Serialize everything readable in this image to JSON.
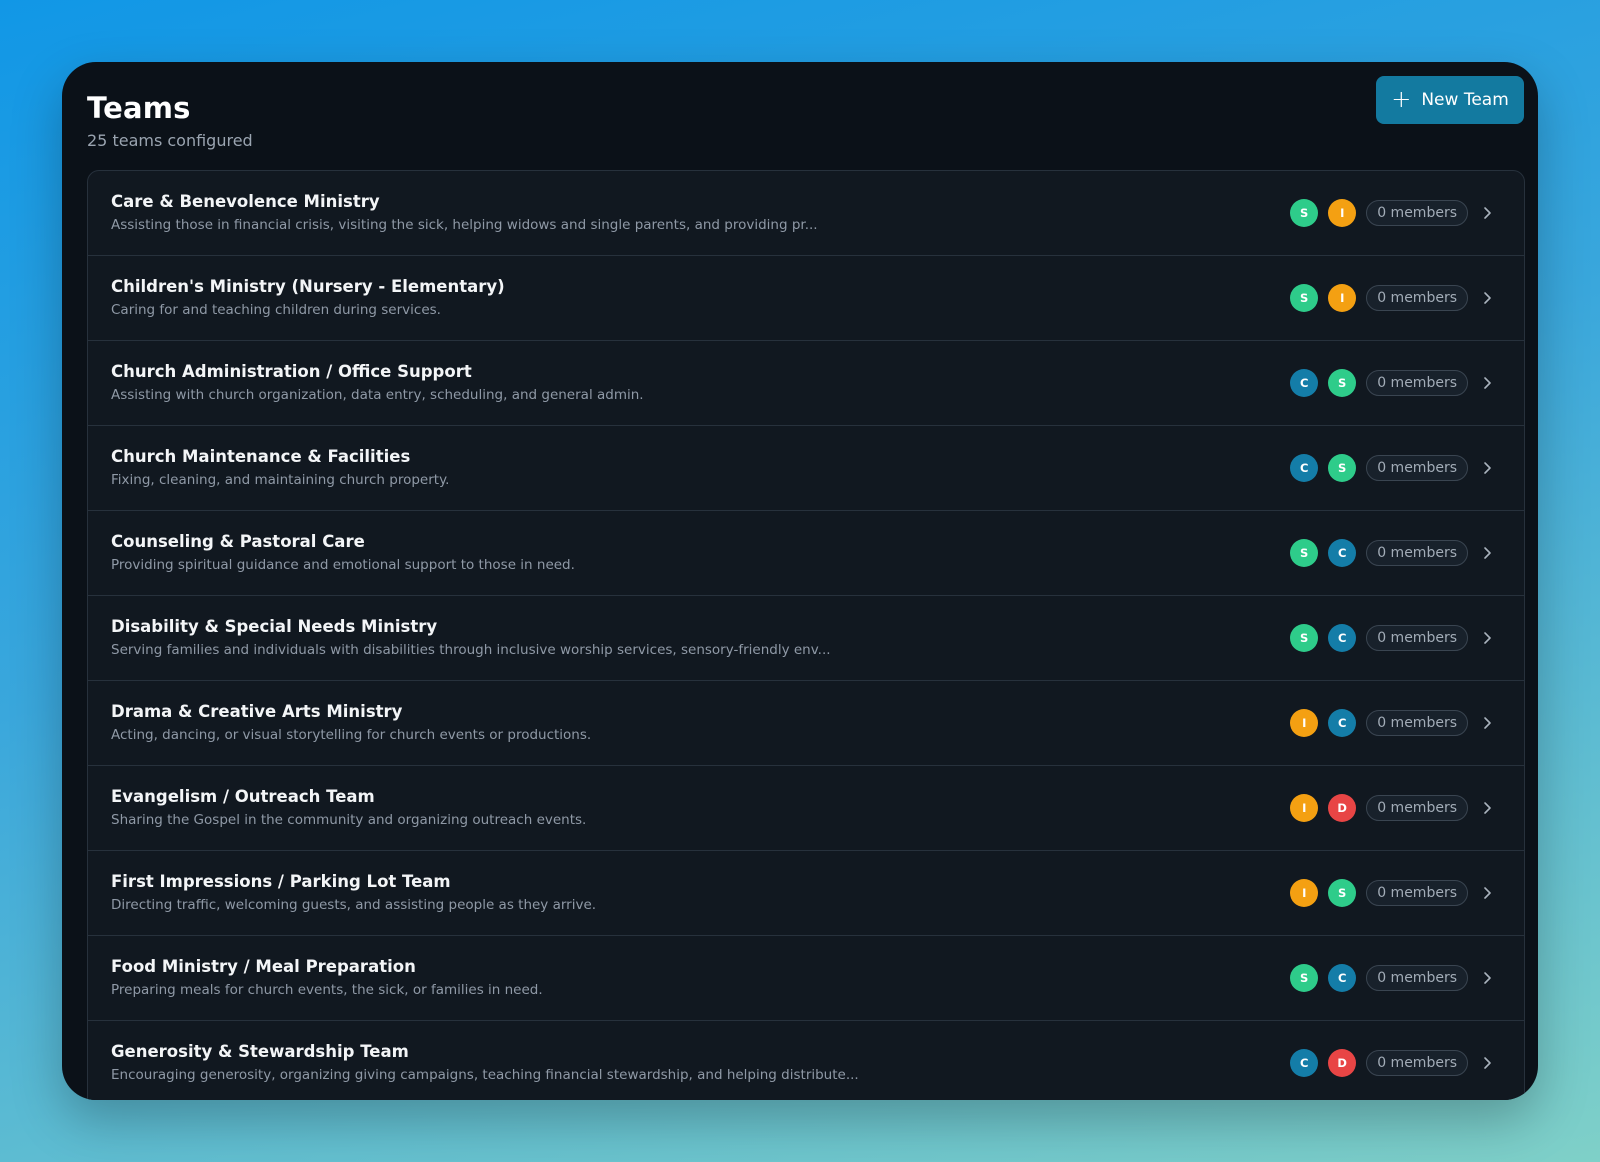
{
  "header": {
    "title": "Teams",
    "subtitle": "25 teams configured",
    "new_team_label": "New Team",
    "new_team_icon": "plus-icon"
  },
  "role_colors": {
    "S": "#2ecc8a",
    "I": "#f4a012",
    "C": "#147da8",
    "D": "#e84545"
  },
  "teams": [
    {
      "name": "Care & Benevolence Ministry",
      "description": "Assisting those in financial crisis, visiting the sick, helping widows and single parents, and providing pr...",
      "roles": [
        "S",
        "I"
      ],
      "members": "0 members"
    },
    {
      "name": "Children's Ministry (Nursery - Elementary)",
      "description": "Caring for and teaching children during services.",
      "roles": [
        "S",
        "I"
      ],
      "members": "0 members"
    },
    {
      "name": "Church Administration / Office Support",
      "description": "Assisting with church organization, data entry, scheduling, and general admin.",
      "roles": [
        "C",
        "S"
      ],
      "members": "0 members"
    },
    {
      "name": "Church Maintenance & Facilities",
      "description": "Fixing, cleaning, and maintaining church property.",
      "roles": [
        "C",
        "S"
      ],
      "members": "0 members"
    },
    {
      "name": "Counseling & Pastoral Care",
      "description": "Providing spiritual guidance and emotional support to those in need.",
      "roles": [
        "S",
        "C"
      ],
      "members": "0 members"
    },
    {
      "name": "Disability & Special Needs Ministry",
      "description": "Serving families and individuals with disabilities through inclusive worship services, sensory-friendly env...",
      "roles": [
        "S",
        "C"
      ],
      "members": "0 members"
    },
    {
      "name": "Drama & Creative Arts Ministry",
      "description": "Acting, dancing, or visual storytelling for church events or productions.",
      "roles": [
        "I",
        "C"
      ],
      "members": "0 members"
    },
    {
      "name": "Evangelism / Outreach Team",
      "description": "Sharing the Gospel in the community and organizing outreach events.",
      "roles": [
        "I",
        "D"
      ],
      "members": "0 members"
    },
    {
      "name": "First Impressions / Parking Lot Team",
      "description": "Directing traffic, welcoming guests, and assisting people as they arrive.",
      "roles": [
        "I",
        "S"
      ],
      "members": "0 members"
    },
    {
      "name": "Food Ministry / Meal Preparation",
      "description": "Preparing meals for church events, the sick, or families in need.",
      "roles": [
        "S",
        "C"
      ],
      "members": "0 members"
    },
    {
      "name": "Generosity & Stewardship Team",
      "description": "Encouraging generosity, organizing giving campaigns, teaching financial stewardship, and helping distribute...",
      "roles": [
        "C",
        "D"
      ],
      "members": "0 members"
    }
  ]
}
